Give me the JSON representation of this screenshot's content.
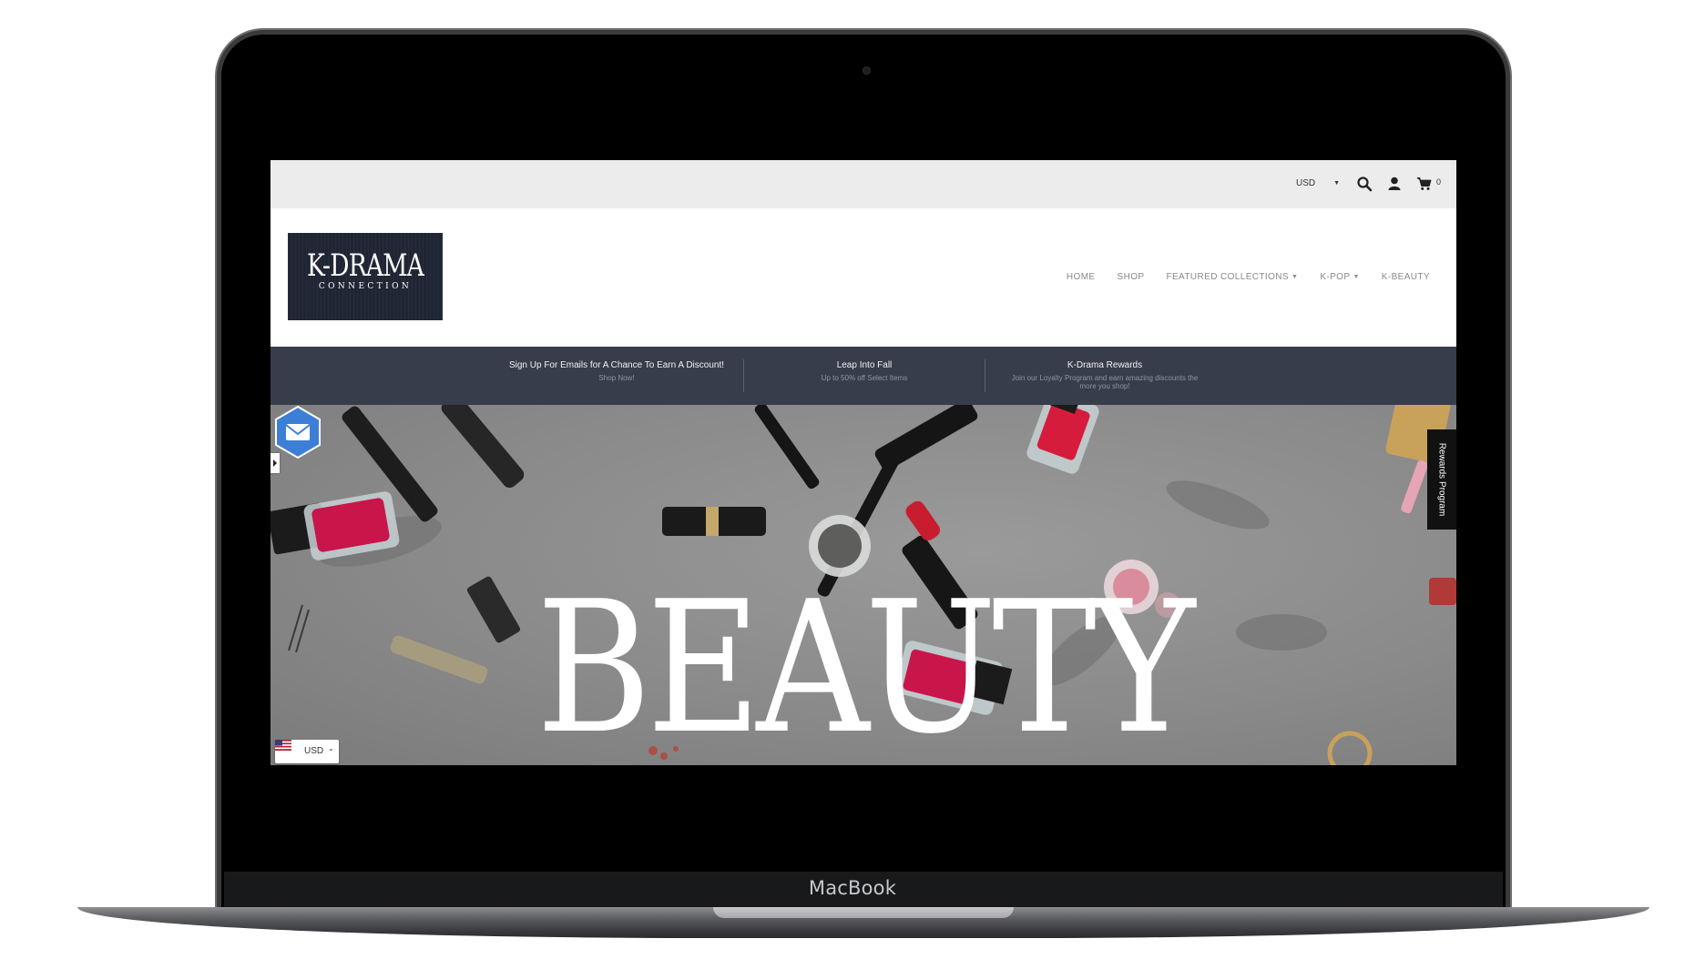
{
  "device": {
    "label": "MacBook"
  },
  "topbar": {
    "currency": "USD",
    "cart_count": "0"
  },
  "logo": {
    "main": "K-DRAMA",
    "sub": "CONNECTION"
  },
  "nav": {
    "items": [
      {
        "label": "HOME"
      },
      {
        "label": "SHOP"
      },
      {
        "label": "FEATURED COLLECTIONS"
      },
      {
        "label": "K-POP"
      },
      {
        "label": "K-BEAUTY"
      }
    ]
  },
  "promo": [
    {
      "title": "Sign Up For Emails for A Chance To Earn A Discount!",
      "subtitle": "Shop Now!"
    },
    {
      "title": "Leap Into Fall",
      "subtitle": "Up to 50% off Select Items"
    },
    {
      "title": "K-Drama Rewards",
      "subtitle": "Join our Loyalty Program and earn amazing discounts the more you shop!"
    }
  ],
  "hero": {
    "title": "BEAUTY"
  },
  "rewards_tab": {
    "label": "Rewards Program"
  },
  "currency_widget": {
    "label": "USD"
  },
  "colors": {
    "promo_bg": "#373d4a",
    "logo_bg": "#1f2533",
    "mail_badge": "#3d7fd6"
  }
}
